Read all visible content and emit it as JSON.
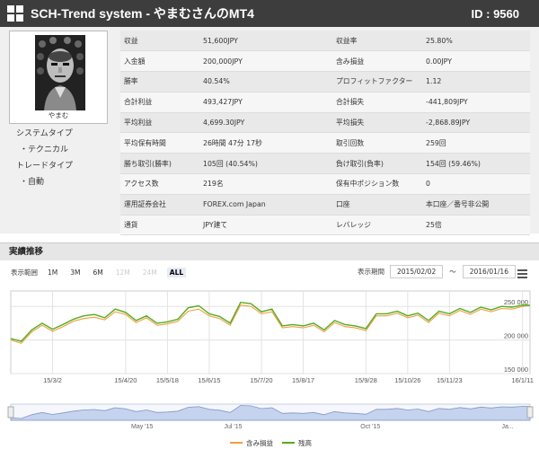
{
  "header": {
    "title": "SCH-Trend system - やまむさんのMT4",
    "id_text": "ID : 9560"
  },
  "profile": {
    "name": "やまむ",
    "side_items": [
      "システムタイプ",
      "・テクニカル",
      "トレードタイプ",
      "・自動"
    ]
  },
  "stats": [
    {
      "l1": "収益",
      "v1": "51,600JPY",
      "l2": "収益率",
      "v2": "25.80%"
    },
    {
      "l1": "入金額",
      "v1": "200,000JPY",
      "l2": "含み損益",
      "v2": "0.00JPY"
    },
    {
      "l1": "勝率",
      "v1": "40.54%",
      "l2": "プロフィットファクター",
      "v2": "1.12"
    },
    {
      "l1": "合計利益",
      "v1": "493,427JPY",
      "l2": "合計損失",
      "v2": "-441,809JPY"
    },
    {
      "l1": "平均利益",
      "v1": "4,699.30JPY",
      "l2": "平均損失",
      "v2": "-2,868.89JPY"
    },
    {
      "l1": "平均保有時間",
      "v1": "26時間 47分 17秒",
      "l2": "取引回数",
      "v2": "259回"
    },
    {
      "l1": "勝ち取引(勝率)",
      "v1": "105回 (40.54%)",
      "l2": "負け取引(負率)",
      "v2": "154回 (59.46%)"
    },
    {
      "l1": "アクセス数",
      "v1": "219名",
      "l2": "保有中ポジション数",
      "v2": "0"
    },
    {
      "l1": "運用証券会社",
      "v1": "FOREX.com Japan",
      "l2": "口座",
      "v2": "本口座／番号非公開"
    },
    {
      "l1": "通貨",
      "v1": "JPY建て",
      "l2": "レバレッジ",
      "v2": "25倍"
    }
  ],
  "performance": {
    "header": "実績推移",
    "range_label": "表示範囲",
    "range_buttons": [
      {
        "label": "1M",
        "state": "normal"
      },
      {
        "label": "3M",
        "state": "normal"
      },
      {
        "label": "6M",
        "state": "normal"
      },
      {
        "label": "12M",
        "state": "disabled"
      },
      {
        "label": "24M",
        "state": "disabled"
      },
      {
        "label": "ALL",
        "state": "active"
      }
    ],
    "period_label": "表示期間",
    "date_from": "2015/02/02",
    "date_tilde": "〜",
    "date_to": "2016/01/16",
    "menu_icon": "hamburger-menu-icon"
  },
  "chart_data": {
    "type": "line",
    "x_range": [
      "2015-02-02",
      "2016-01-16"
    ],
    "ylim": [
      150000,
      265000
    ],
    "y_ticks": [
      {
        "value": 250000,
        "label": "250 000"
      },
      {
        "value": 200000,
        "label": "200 000"
      },
      {
        "value": 150000,
        "label": "150 000"
      }
    ],
    "x_ticks": [
      {
        "date": "2015-03-02",
        "label": "15/3/2"
      },
      {
        "date": "2015-04-20",
        "label": "15/4/20"
      },
      {
        "date": "2015-05-18",
        "label": "15/5/18"
      },
      {
        "date": "2015-06-15",
        "label": "15/6/15"
      },
      {
        "date": "2015-07-20",
        "label": "15/7/20"
      },
      {
        "date": "2015-08-17",
        "label": "15/8/17"
      },
      {
        "date": "2015-09-28",
        "label": "15/9/28"
      },
      {
        "date": "2015-10-26",
        "label": "15/10/26"
      },
      {
        "date": "2015-11-23",
        "label": "15/11/23"
      },
      {
        "date": "2016-01-11",
        "label": "16/1/11"
      }
    ],
    "navigator_ticks": [
      {
        "date": "2015-05-01",
        "label": "May '15"
      },
      {
        "date": "2015-07-01",
        "label": "Jul '15"
      },
      {
        "date": "2015-10-01",
        "label": "Oct '15"
      },
      {
        "date": "2016-01-01",
        "label": "Ja..."
      }
    ],
    "x": [
      "2015-02-02",
      "2015-02-09",
      "2015-02-16",
      "2015-02-23",
      "2015-03-02",
      "2015-03-09",
      "2015-03-16",
      "2015-03-23",
      "2015-03-30",
      "2015-04-06",
      "2015-04-13",
      "2015-04-20",
      "2015-04-27",
      "2015-05-04",
      "2015-05-11",
      "2015-05-18",
      "2015-05-25",
      "2015-06-01",
      "2015-06-08",
      "2015-06-15",
      "2015-06-22",
      "2015-06-29",
      "2015-07-06",
      "2015-07-13",
      "2015-07-20",
      "2015-07-27",
      "2015-08-03",
      "2015-08-10",
      "2015-08-17",
      "2015-08-24",
      "2015-08-31",
      "2015-09-07",
      "2015-09-14",
      "2015-09-21",
      "2015-09-28",
      "2015-10-05",
      "2015-10-12",
      "2015-10-19",
      "2015-10-26",
      "2015-11-02",
      "2015-11-09",
      "2015-11-16",
      "2015-11-23",
      "2015-11-30",
      "2015-12-07",
      "2015-12-14",
      "2015-12-21",
      "2015-12-28",
      "2016-01-04",
      "2016-01-11",
      "2016-01-16"
    ],
    "series": [
      {
        "name": "含み損益",
        "color": "#f0a040",
        "values": [
          200000,
          195000,
          212000,
          222000,
          213000,
          220000,
          228000,
          232000,
          234000,
          230000,
          242000,
          238000,
          226000,
          233000,
          222000,
          224000,
          228000,
          243000,
          246000,
          236000,
          232000,
          222000,
          252000,
          250000,
          239000,
          242000,
          218000,
          220000,
          218000,
          222000,
          212000,
          226000,
          220000,
          218000,
          214000,
          236000,
          236000,
          240000,
          233000,
          237000,
          226000,
          240000,
          236000,
          244000,
          238000,
          246000,
          242000,
          247000,
          246000,
          250000,
          251600
        ]
      },
      {
        "name": "残高",
        "color": "#55aa22",
        "values": [
          202000,
          198000,
          215000,
          225000,
          216000,
          223000,
          231000,
          236000,
          238000,
          233000,
          246000,
          241000,
          229000,
          236000,
          225000,
          227000,
          231000,
          248000,
          251000,
          239000,
          235000,
          225000,
          256000,
          254000,
          242000,
          246000,
          221000,
          223000,
          221000,
          225000,
          215000,
          229000,
          223000,
          221000,
          217000,
          239000,
          239000,
          243000,
          236000,
          240000,
          229000,
          243000,
          239000,
          247000,
          241000,
          249000,
          245000,
          250000,
          249000,
          252000,
          251600
        ]
      }
    ],
    "legend_position": "bottom-center",
    "grid": true
  }
}
